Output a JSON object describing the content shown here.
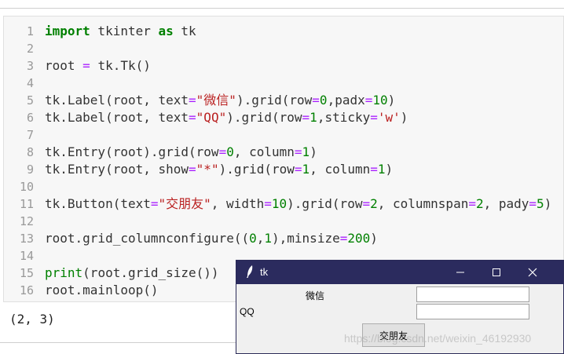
{
  "notebook": {
    "code_lines": [
      [
        {
          "t": "import",
          "c": "kw"
        },
        {
          "t": " tkinter "
        },
        {
          "t": "as",
          "c": "kw"
        },
        {
          "t": " tk"
        }
      ],
      [],
      [
        {
          "t": "root "
        },
        {
          "t": "=",
          "c": "op"
        },
        {
          "t": " tk.Tk()"
        }
      ],
      [],
      [
        {
          "t": "tk.Label(root, text"
        },
        {
          "t": "=",
          "c": "op"
        },
        {
          "t": "\"微信\"",
          "c": "str"
        },
        {
          "t": ").grid(row"
        },
        {
          "t": "=",
          "c": "op"
        },
        {
          "t": "0",
          "c": "num"
        },
        {
          "t": ",padx"
        },
        {
          "t": "=",
          "c": "op"
        },
        {
          "t": "10",
          "c": "num"
        },
        {
          "t": ")"
        }
      ],
      [
        {
          "t": "tk.Label(root, text"
        },
        {
          "t": "=",
          "c": "op"
        },
        {
          "t": "\"QQ\"",
          "c": "str"
        },
        {
          "t": ").grid(row"
        },
        {
          "t": "=",
          "c": "op"
        },
        {
          "t": "1",
          "c": "num"
        },
        {
          "t": ",sticky"
        },
        {
          "t": "=",
          "c": "op"
        },
        {
          "t": "'w'",
          "c": "str"
        },
        {
          "t": ")"
        }
      ],
      [],
      [
        {
          "t": "tk.Entry(root).grid(row"
        },
        {
          "t": "=",
          "c": "op"
        },
        {
          "t": "0",
          "c": "num"
        },
        {
          "t": ", column"
        },
        {
          "t": "=",
          "c": "op"
        },
        {
          "t": "1",
          "c": "num"
        },
        {
          "t": ")"
        }
      ],
      [
        {
          "t": "tk.Entry(root, show"
        },
        {
          "t": "=",
          "c": "op"
        },
        {
          "t": "\"*\"",
          "c": "str"
        },
        {
          "t": ").grid(row"
        },
        {
          "t": "=",
          "c": "op"
        },
        {
          "t": "1",
          "c": "num"
        },
        {
          "t": ", column"
        },
        {
          "t": "=",
          "c": "op"
        },
        {
          "t": "1",
          "c": "num"
        },
        {
          "t": ")"
        }
      ],
      [],
      [
        {
          "t": "tk.Button(text"
        },
        {
          "t": "=",
          "c": "op"
        },
        {
          "t": "\"交朋友\"",
          "c": "str"
        },
        {
          "t": ", width"
        },
        {
          "t": "=",
          "c": "op"
        },
        {
          "t": "10",
          "c": "num"
        },
        {
          "t": ").grid(row"
        },
        {
          "t": "=",
          "c": "op"
        },
        {
          "t": "2",
          "c": "num"
        },
        {
          "t": ", columnspan"
        },
        {
          "t": "=",
          "c": "op"
        },
        {
          "t": "2",
          "c": "num"
        },
        {
          "t": ", pady"
        },
        {
          "t": "=",
          "c": "op"
        },
        {
          "t": "5",
          "c": "num"
        },
        {
          "t": ")"
        }
      ],
      [],
      [
        {
          "t": "root.grid_columnconfigure(("
        },
        {
          "t": "0",
          "c": "num"
        },
        {
          "t": ","
        },
        {
          "t": "1",
          "c": "num"
        },
        {
          "t": "),minsize"
        },
        {
          "t": "=",
          "c": "op"
        },
        {
          "t": "200",
          "c": "num"
        },
        {
          "t": ")"
        }
      ],
      [],
      [
        {
          "t": "print",
          "c": "bi"
        },
        {
          "t": "(root.grid_size())"
        }
      ],
      [
        {
          "t": "root.mainloop()"
        }
      ]
    ],
    "line_numbers": [
      "1",
      "2",
      "3",
      "4",
      "5",
      "6",
      "7",
      "8",
      "9",
      "10",
      "11",
      "12",
      "13",
      "14",
      "15",
      "16"
    ],
    "output": "(2, 3)"
  },
  "tk_window": {
    "title": "tk",
    "label_wechat": "微信",
    "label_qq": "QQ",
    "button_label": "交朋友",
    "titlebar_color": "#2b2b5e"
  },
  "watermark": "https://blog.csdn.net/weixin_46192930"
}
